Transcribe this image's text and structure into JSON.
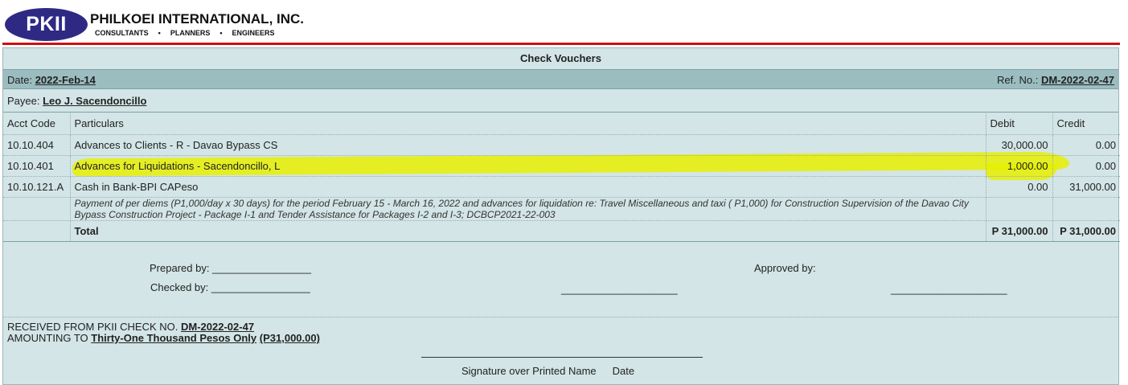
{
  "header": {
    "logo_text": "PKII",
    "company_name": "PHILKOEI INTERNATIONAL, INC.",
    "tagline": [
      "CONSULTANTS",
      "PLANNERS",
      "ENGINEERS"
    ],
    "tagline_separator": "•"
  },
  "voucher": {
    "title": "Check Vouchers",
    "date_label": "Date:",
    "date_value": "2022-Feb-14",
    "ref_label": "Ref. No.:",
    "ref_value": "DM-2022-02-47",
    "payee_label": "Payee:",
    "payee_value": "Leo J. Sacendoncillo",
    "columns": [
      "Acct Code",
      "Particulars",
      "Debit",
      "Credit"
    ],
    "rows": [
      {
        "code": "10.10.404",
        "particulars": "Advances to Clients - R - Davao Bypass CS",
        "debit": "30,000.00",
        "credit": "0.00"
      },
      {
        "code": "10.10.401",
        "particulars": "Advances for Liquidations - Sacendoncillo, L",
        "debit": "1,000.00",
        "credit": "0.00"
      },
      {
        "code": "10.10.121.A",
        "particulars": "Cash in Bank-BPI CAPeso",
        "debit": "0.00",
        "credit": "31,000.00"
      }
    ],
    "description": "Payment of per diems (P1,000/day x 30 days) for the period February 15 - March 16, 2022 and advances for liquidation re: Travel Miscellaneous and taxi ( P1,000) for Construction Supervision of the Davao City Bypass Construction Project - Package I-1 and Tender Assistance for Packages I-2 and I-3; DCBCP2021-22-003",
    "total_label": "Total",
    "total_debit": "P 31,000.00",
    "total_credit": "P 31,000.00"
  },
  "signatures": {
    "prepared_by": "Prepared by: _________________",
    "checked_by": "Checked by: _________________",
    "approved_by": "Approved by:",
    "approver_line_1": "____________________",
    "approver_line_2": "____________________"
  },
  "received": {
    "line1_prefix": "RECEIVED FROM PKII CHECK NO.",
    "check_no": "DM-2022-02-47",
    "line2_prefix": "AMOUNTING TO",
    "amount_words": "Thirty-One Thousand Pesos Only",
    "amount_figure": "(P31,000.00)",
    "signature_caption": "Signature over Printed Name",
    "date_caption": "Date"
  },
  "colors": {
    "logo": "#2e2a84",
    "rule": "#cc1111",
    "panel": "#d3e5e6",
    "date_bar": "#9bbdc0",
    "highlight": "#e6f000"
  }
}
